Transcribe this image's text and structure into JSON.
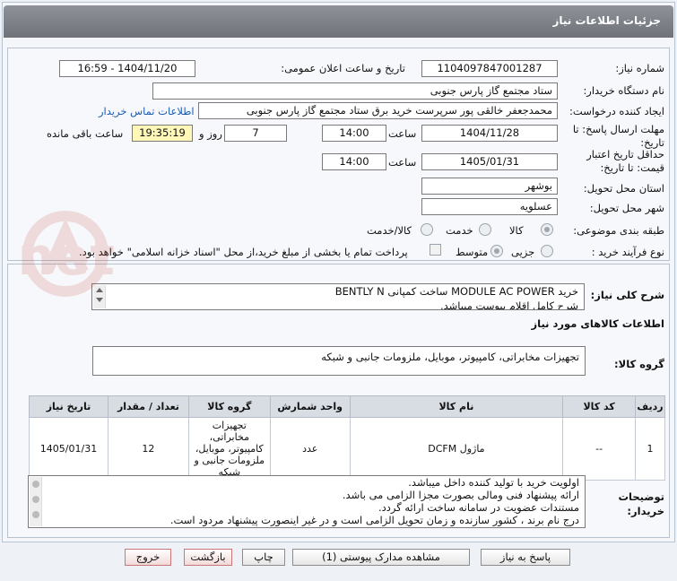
{
  "header": {
    "title": "جزئیات اطلاعات نیاز"
  },
  "form": {
    "need_number_label": "شماره نیاز:",
    "need_number": "1104097847001287",
    "announce_label": "تاریخ و ساعت اعلان عمومی:",
    "announce_value": "1404/11/20 - 16:59",
    "buyer_org_label": "نام دستگاه خریدار:",
    "buyer_org": "ستاد مجتمع گاز پارس جنوبی",
    "creator_label": "ایجاد کننده درخواست:",
    "creator": "محمدجعفر خالقی پور سرپرست خرید برق ستاد مجتمع گاز پارس جنوبی",
    "contact_link": "اطلاعات تماس خریدار",
    "reply_deadline_label": "مهلت ارسال پاسخ: تا تاریخ:",
    "reply_date": "1404/11/28",
    "time_label": "ساعت",
    "reply_time": "14:00",
    "days_value": "7",
    "days_label": "روز و",
    "remaining_time": "19:35:19",
    "remaining_label": "ساعت باقی مانده",
    "validity_label": "حداقل تاریخ اعتبار قیمت: تا تاریخ:",
    "validity_date": "1405/01/31",
    "validity_time": "14:00",
    "province_label": "استان محل تحویل:",
    "province": "بوشهر",
    "city_label": "شهر محل تحویل:",
    "city": "عسلویه",
    "category_label": "طبقه بندی موضوعی:",
    "category_options": [
      "کالا",
      "خدمت",
      "کالا/خدمت"
    ],
    "process_label": "نوع فرآیند خرید :",
    "process_options": [
      "جزیی",
      "متوسط"
    ],
    "payment_note": "پرداخت تمام یا بخشی از مبلغ خرید،از محل \"اسناد خزانه اسلامی\" خواهد بود."
  },
  "description": {
    "label": "شرح کلی نیاز:",
    "line1": "خرید MODULE AC POWER  ساخت کمپانی BENTLY N",
    "line2": "شرح کامل اقلام پیوست میباشد."
  },
  "goods": {
    "section_title": "اطلاعات کالاهای مورد نیاز",
    "group_label": "گروه کالا:",
    "group_value": "تجهیزات مخابراتی، کامپیوتر، موبایل، ملزومات جانبی و شبکه",
    "columns": [
      "ردیف",
      "کد کالا",
      "نام کالا",
      "واحد شمارش",
      "گروه کالا",
      "تعداد / مقدار",
      "تاریخ نیاز"
    ],
    "rows": [
      {
        "row": "1",
        "code": "--",
        "name": "ماژول DCFM",
        "unit": "عدد",
        "group": "تجهیزات مخابراتی، کامپیوتر، موبایل، ملزومات جانبی و شبکه",
        "qty": "12",
        "date": "1405/01/31"
      }
    ]
  },
  "buyer_notes": {
    "label": "توضیحات خریدار:",
    "lines": [
      "اولویت خرید با تولید کننده داخل میباشد.",
      "ارائه پیشنهاد فنی ومالی بصورت مجزا الزامی می باشد.",
      "مستندات عضویت در سامانه ساخت ارائه گردد.",
      "درج نام برند ، کشور سازنده و زمان تحویل الزامی است و در غیر اینصورت پیشنهاد مردود است."
    ]
  },
  "buttons": {
    "reply": "پاسخ به نیاز",
    "attachments": "مشاهده مدارک پیوستی (1)",
    "print": "چاپ",
    "back": "بازگشت",
    "exit": "خروج"
  },
  "watermark": "AriaTender.net",
  "colors": {
    "titlebar": "#7f8289",
    "highlight": "#fff7b8",
    "link": "#1c5bb0"
  }
}
